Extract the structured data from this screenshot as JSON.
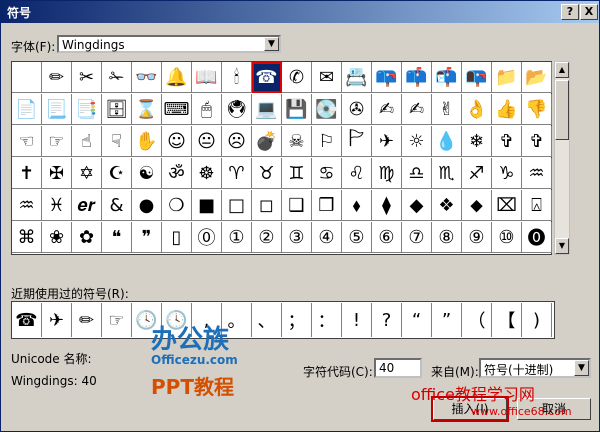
{
  "window": {
    "title": "符号",
    "help_label": "?",
    "close_label": "X"
  },
  "font": {
    "label": "字体(F):",
    "value": "Wingdings"
  },
  "symbol_grid": {
    "rows": [
      [
        " ",
        "✏",
        "✂",
        "✁",
        "👓",
        "🔔",
        "📖",
        "🕯",
        "☎",
        "✆",
        "✉",
        "📇",
        "📪",
        "📫",
        "📬",
        "📭",
        "📁",
        "📂"
      ],
      [
        "📄",
        "📃",
        "📑",
        "🗄",
        "⌛",
        "⌨",
        "🖱",
        "🖲",
        "💻",
        "💾",
        "💽",
        "✇",
        "✍",
        "✍",
        "✌",
        "👌",
        "👍",
        "👎"
      ],
      [
        "☜",
        "☞",
        "☝",
        "☟",
        "✋",
        "☺",
        "😐",
        "☹",
        "💣",
        "☠",
        "⚐",
        "🏱",
        "✈",
        "☼",
        "💧",
        "❄",
        "✞",
        "✞"
      ],
      [
        "✝",
        "✠",
        "✡",
        "☪",
        "☯",
        "ॐ",
        "☸",
        "♈",
        "♉",
        "♊",
        "♋",
        "♌",
        "♍",
        "♎",
        "♏",
        "♐",
        "♑",
        "♒"
      ],
      [
        "♒",
        "♓",
        "𝒆𝒓",
        "&",
        "●",
        "❍",
        "■",
        "□",
        "◻",
        "❑",
        "❒",
        "⬧",
        "⧫",
        "◆",
        "❖",
        "⬥",
        "⌧",
        "⍓"
      ],
      [
        "⌘",
        "❀",
        "✿",
        "❝",
        "❞",
        "▯",
        "⓪",
        "①",
        "②",
        "③",
        "④",
        "⑤",
        "⑥",
        "⑦",
        "⑧",
        "⑨",
        "⑩",
        "⓿"
      ]
    ],
    "selected_row": 0,
    "selected_col": 8
  },
  "recent": {
    "label": "近期使用过的符号(R):",
    "symbols": [
      "☎",
      "✈",
      "✏",
      "☞",
      "🕓",
      "🕓",
      ",",
      "。",
      "、",
      "；",
      "：",
      "!",
      "?",
      "“",
      "”",
      "（",
      "【",
      ")"
    ]
  },
  "unicode_name_label": "Unicode 名称:",
  "char_description": "Wingdings: 40",
  "char_code": {
    "label": "字符代码(C):",
    "value": "40"
  },
  "from": {
    "label": "来自(M):",
    "value": "符号(十进制)"
  },
  "buttons": {
    "insert": "插入(I)",
    "cancel": "取消"
  },
  "watermarks": {
    "brand_cn": "办公族",
    "brand_domain": "Officezu.com",
    "ppt_tutorial": "PPT教程",
    "site_cn": "office教程学习网",
    "site_url": "www.office68.com"
  },
  "colors": {
    "title_bar": "#0a246a",
    "selection_outline": "#e00000",
    "watermark_red": "#d40000",
    "watermark_blue": "#1c6fb8"
  }
}
